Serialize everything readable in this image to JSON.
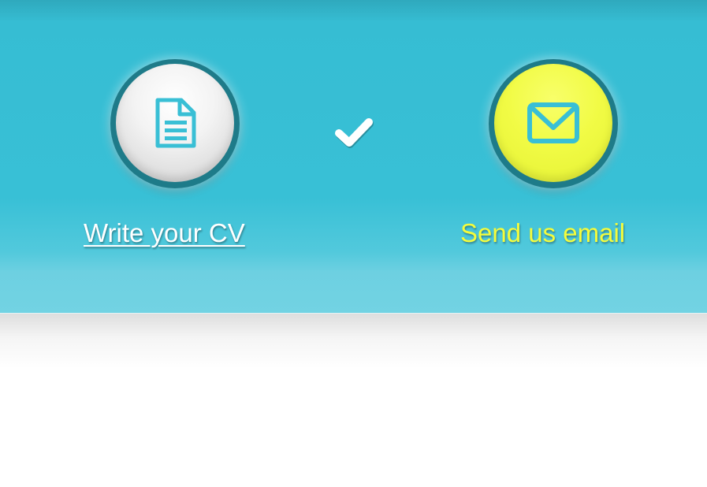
{
  "steps": [
    {
      "label": "Write your CV",
      "icon": "document-icon",
      "status": "completed",
      "accent": "#ffffff"
    },
    {
      "label": "Send us email",
      "icon": "envelope-icon",
      "status": "current",
      "accent": "#f4fc3c"
    }
  ],
  "separator_icon": "checkmark-icon",
  "colors": {
    "banner": "#38c0d6",
    "icon": "#39bfd5",
    "ring": "#1e7b89",
    "active_step": "#f1fb45"
  }
}
